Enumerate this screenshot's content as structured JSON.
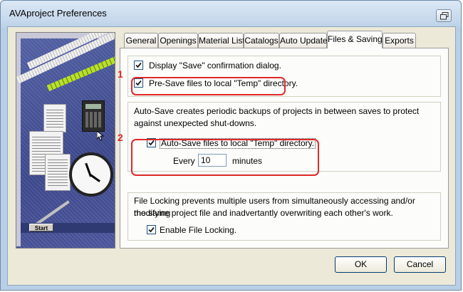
{
  "window": {
    "title": "AVAproject Preferences"
  },
  "tabs": [
    {
      "label": "General"
    },
    {
      "label": "Openings"
    },
    {
      "label": "Material List"
    },
    {
      "label": "Catalogs"
    },
    {
      "label": "Auto Update"
    },
    {
      "label": "Files & Saving",
      "active": true
    },
    {
      "label": "Exports"
    }
  ],
  "group1": {
    "display_save": {
      "label": "Display \"Save\" confirmation dialog.",
      "checked": true
    },
    "presave": {
      "label": "Pre-Save files to local \"Temp\" directory.",
      "checked": true
    }
  },
  "group2": {
    "description_line1": "Auto-Save creates periodic backups of projects in between saves to protect",
    "description_line2": "against unexpected shut-downs.",
    "autosave": {
      "label": "Auto-Save files to local \"Temp\" directory.",
      "checked": true
    },
    "every_label": "Every",
    "interval_value": "10",
    "minutes_label": "minutes"
  },
  "group3": {
    "description_line1": "File Locking prevents multiple users from simultaneously accessing and/or modifying",
    "description_line2": "the same project file and inadvertantly overwriting each other's work.",
    "locking": {
      "label": "Enable File Locking.",
      "checked": true
    }
  },
  "annotations": {
    "marker1": "1",
    "marker2": "2",
    "color": "#e02828"
  },
  "illustration": {
    "start_label": "Start"
  },
  "buttons": {
    "ok": "OK",
    "cancel": "Cancel"
  }
}
